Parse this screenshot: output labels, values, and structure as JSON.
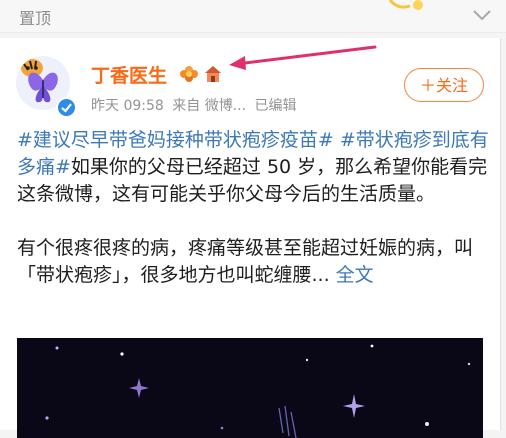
{
  "pinned_bar": {
    "label": "置顶",
    "icon": "chevron-down-icon"
  },
  "post": {
    "author": {
      "name": "丁香医生",
      "avatar_icon": "tiger-butterfly-avatar",
      "verified_icon": "verified-badge-icon",
      "badge_icons": [
        "flower-badge-icon",
        "house-badge-icon"
      ]
    },
    "meta": {
      "time": "昨天 09:58",
      "source": "来自 微博...",
      "edited": "已编辑"
    },
    "follow_label": "＋关注",
    "text": {
      "tag1": "#建议尽早带爸妈接种带状疱疹疫苗#",
      "tag2": "#带状疱疹到底有多痛#",
      "p1_body": "如果你的父母已经超过 50 岁，那么希望你能看完这条微博，这有可能关乎你父母今后的生活质量。",
      "p2_body": "有个很疼很疼的病，疼痛等级甚至能超过妊娠的病，叫「带状疱疹」，很多地方也叫蛇缠腰...",
      "expand_label": "全文"
    }
  },
  "colors": {
    "author": "#f86a16",
    "tag": "#3d79b8",
    "arrow": "#e0306a",
    "verified": "#2d8ce8",
    "media_bg": "#0a0716"
  }
}
